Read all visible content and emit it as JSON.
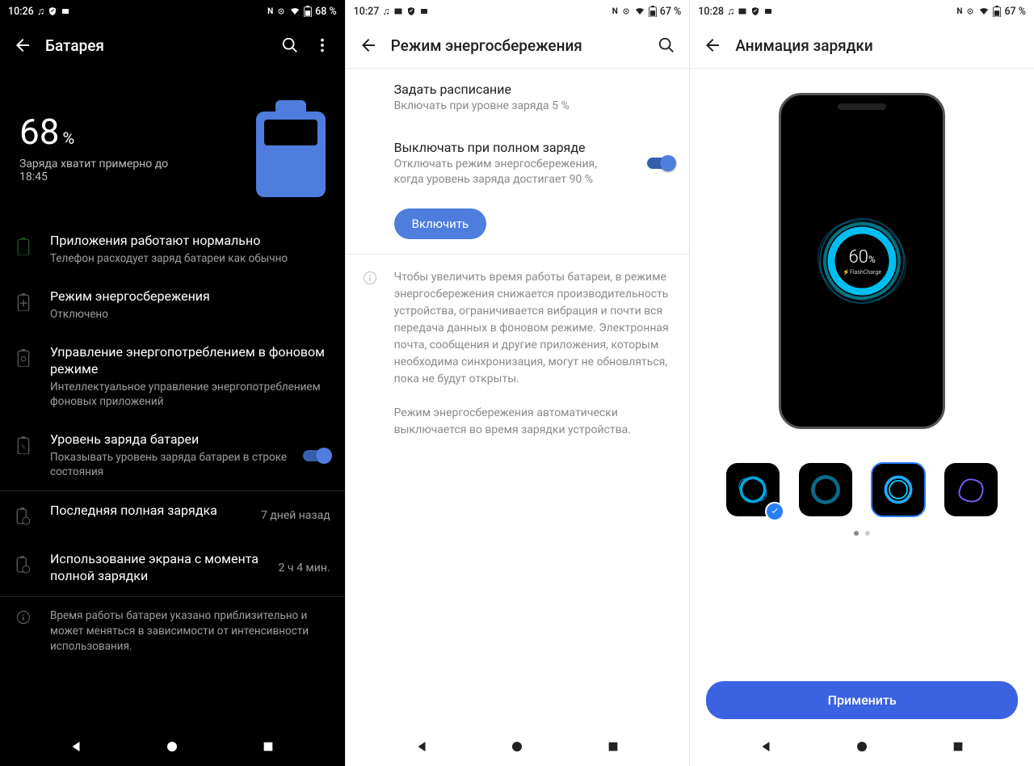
{
  "p1": {
    "status": {
      "time": "10:26",
      "batt": "68 %"
    },
    "title": "Батарея",
    "battery": {
      "pct": "68",
      "pct_sym": "%",
      "estimate": "Заряда хватит примерно до 18:45"
    },
    "apps": {
      "t": "Приложения работают нормально",
      "s": "Телефон расходует заряд батареи как обычно"
    },
    "saver": {
      "t": "Режим энергосбережения",
      "s": "Отключено"
    },
    "bg": {
      "t": "Управление энергопотреблением в фоновом режиме",
      "s": "Интеллектуальное управление энергопотреблением фоновых приложений"
    },
    "level": {
      "t": "Уровень заряда батареи",
      "s": "Показывать уровень заряда батареи в строке состояния"
    },
    "last": {
      "t": "Последняя полная зарядка",
      "v": "7 дней назад"
    },
    "screen": {
      "t": "Использование экрана с момента полной зарядки",
      "v": "2 ч 4 мин."
    },
    "foot": "Время работы батареи указано приблизительно и может меняться в зависимости от интенсивности использования."
  },
  "p2": {
    "status": {
      "time": "10:27",
      "batt": "67 %"
    },
    "title": "Режим энергосбережения",
    "sched": {
      "t": "Задать расписание",
      "s": "Включать при уровне заряда 5 %"
    },
    "off": {
      "t": "Выключать при полном заряде",
      "s": "Отключать режим энергосбережения, когда уровень заряда достигает 90 %"
    },
    "btn": "Включить",
    "info": "Чтобы увеличить время работы батареи, в режиме энергосбережения снижается производительность устройства, ограничивается вибрация и почти вся передача данных в фоновом режиме. Электронная почта, сообщения и другие приложения, которым необходима синхронизация, могут не обновляться, пока не будут открыты.\n\nРежим энергосбережения автоматически выключается во время зарядки устройства."
  },
  "p3": {
    "status": {
      "time": "10:28",
      "batt": "67 %"
    },
    "title": "Анимация зарядки",
    "preview": {
      "pct": "60",
      "pct_sym": "%",
      "brand": "FlashCharge"
    },
    "apply": "Применить"
  }
}
